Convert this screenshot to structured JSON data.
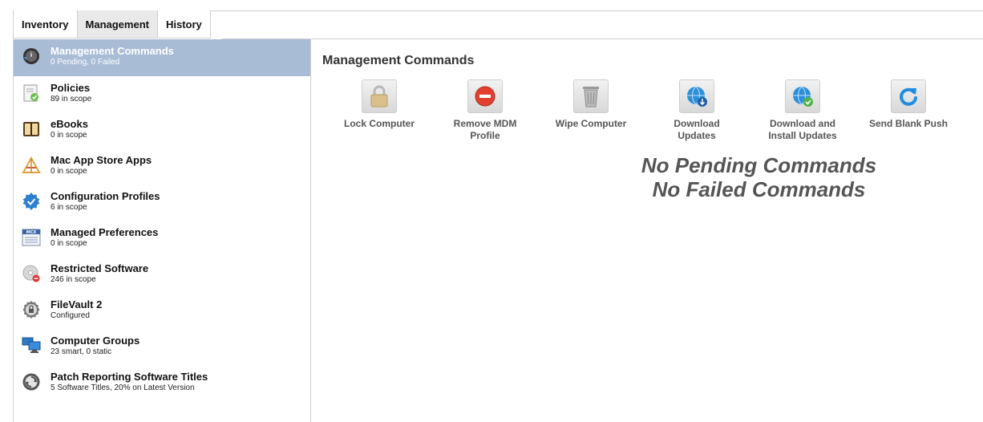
{
  "tabs": [
    {
      "label": "Inventory"
    },
    {
      "label": "Management"
    },
    {
      "label": "History"
    }
  ],
  "sidebar": {
    "items": [
      {
        "title": "Management Commands",
        "subtitle": "0 Pending, 0 Failed",
        "icon": "management-commands-icon"
      },
      {
        "title": "Policies",
        "subtitle": "89 in scope",
        "icon": "policies-icon"
      },
      {
        "title": "eBooks",
        "subtitle": "0 in scope",
        "icon": "ebooks-icon"
      },
      {
        "title": "Mac App Store Apps",
        "subtitle": "0 in scope",
        "icon": "app-store-icon"
      },
      {
        "title": "Configuration Profiles",
        "subtitle": "6 in scope",
        "icon": "configuration-profiles-icon"
      },
      {
        "title": "Managed Preferences",
        "subtitle": "0 in scope",
        "icon": "mcx-icon"
      },
      {
        "title": "Restricted Software",
        "subtitle": "246 in scope",
        "icon": "restricted-software-icon"
      },
      {
        "title": "FileVault 2",
        "subtitle": "Configured",
        "icon": "filevault-icon"
      },
      {
        "title": "Computer Groups",
        "subtitle": "23 smart, 0 static",
        "icon": "computer-groups-icon"
      },
      {
        "title": "Patch Reporting Software Titles",
        "subtitle": "5 Software Titles, 20% on Latest Version",
        "icon": "patch-reporting-icon"
      }
    ]
  },
  "main": {
    "title": "Management Commands",
    "commands": [
      {
        "label": "Lock Computer",
        "icon": "lock-icon"
      },
      {
        "label": "Remove MDM\nProfile",
        "icon": "remove-icon"
      },
      {
        "label": "Wipe Computer",
        "icon": "trash-icon"
      },
      {
        "label": "Download\nUpdates",
        "icon": "globe-download-icon"
      },
      {
        "label": "Download and\nInstall Updates",
        "icon": "globe-install-icon"
      },
      {
        "label": "Send Blank Push",
        "icon": "refresh-icon"
      }
    ],
    "empty_line1": "No Pending Commands",
    "empty_line2": "No Failed Commands"
  },
  "colors": {
    "selected_row": "#a9bcd6",
    "tab_active": "#e9e9e9",
    "border": "#cfcfcf"
  }
}
